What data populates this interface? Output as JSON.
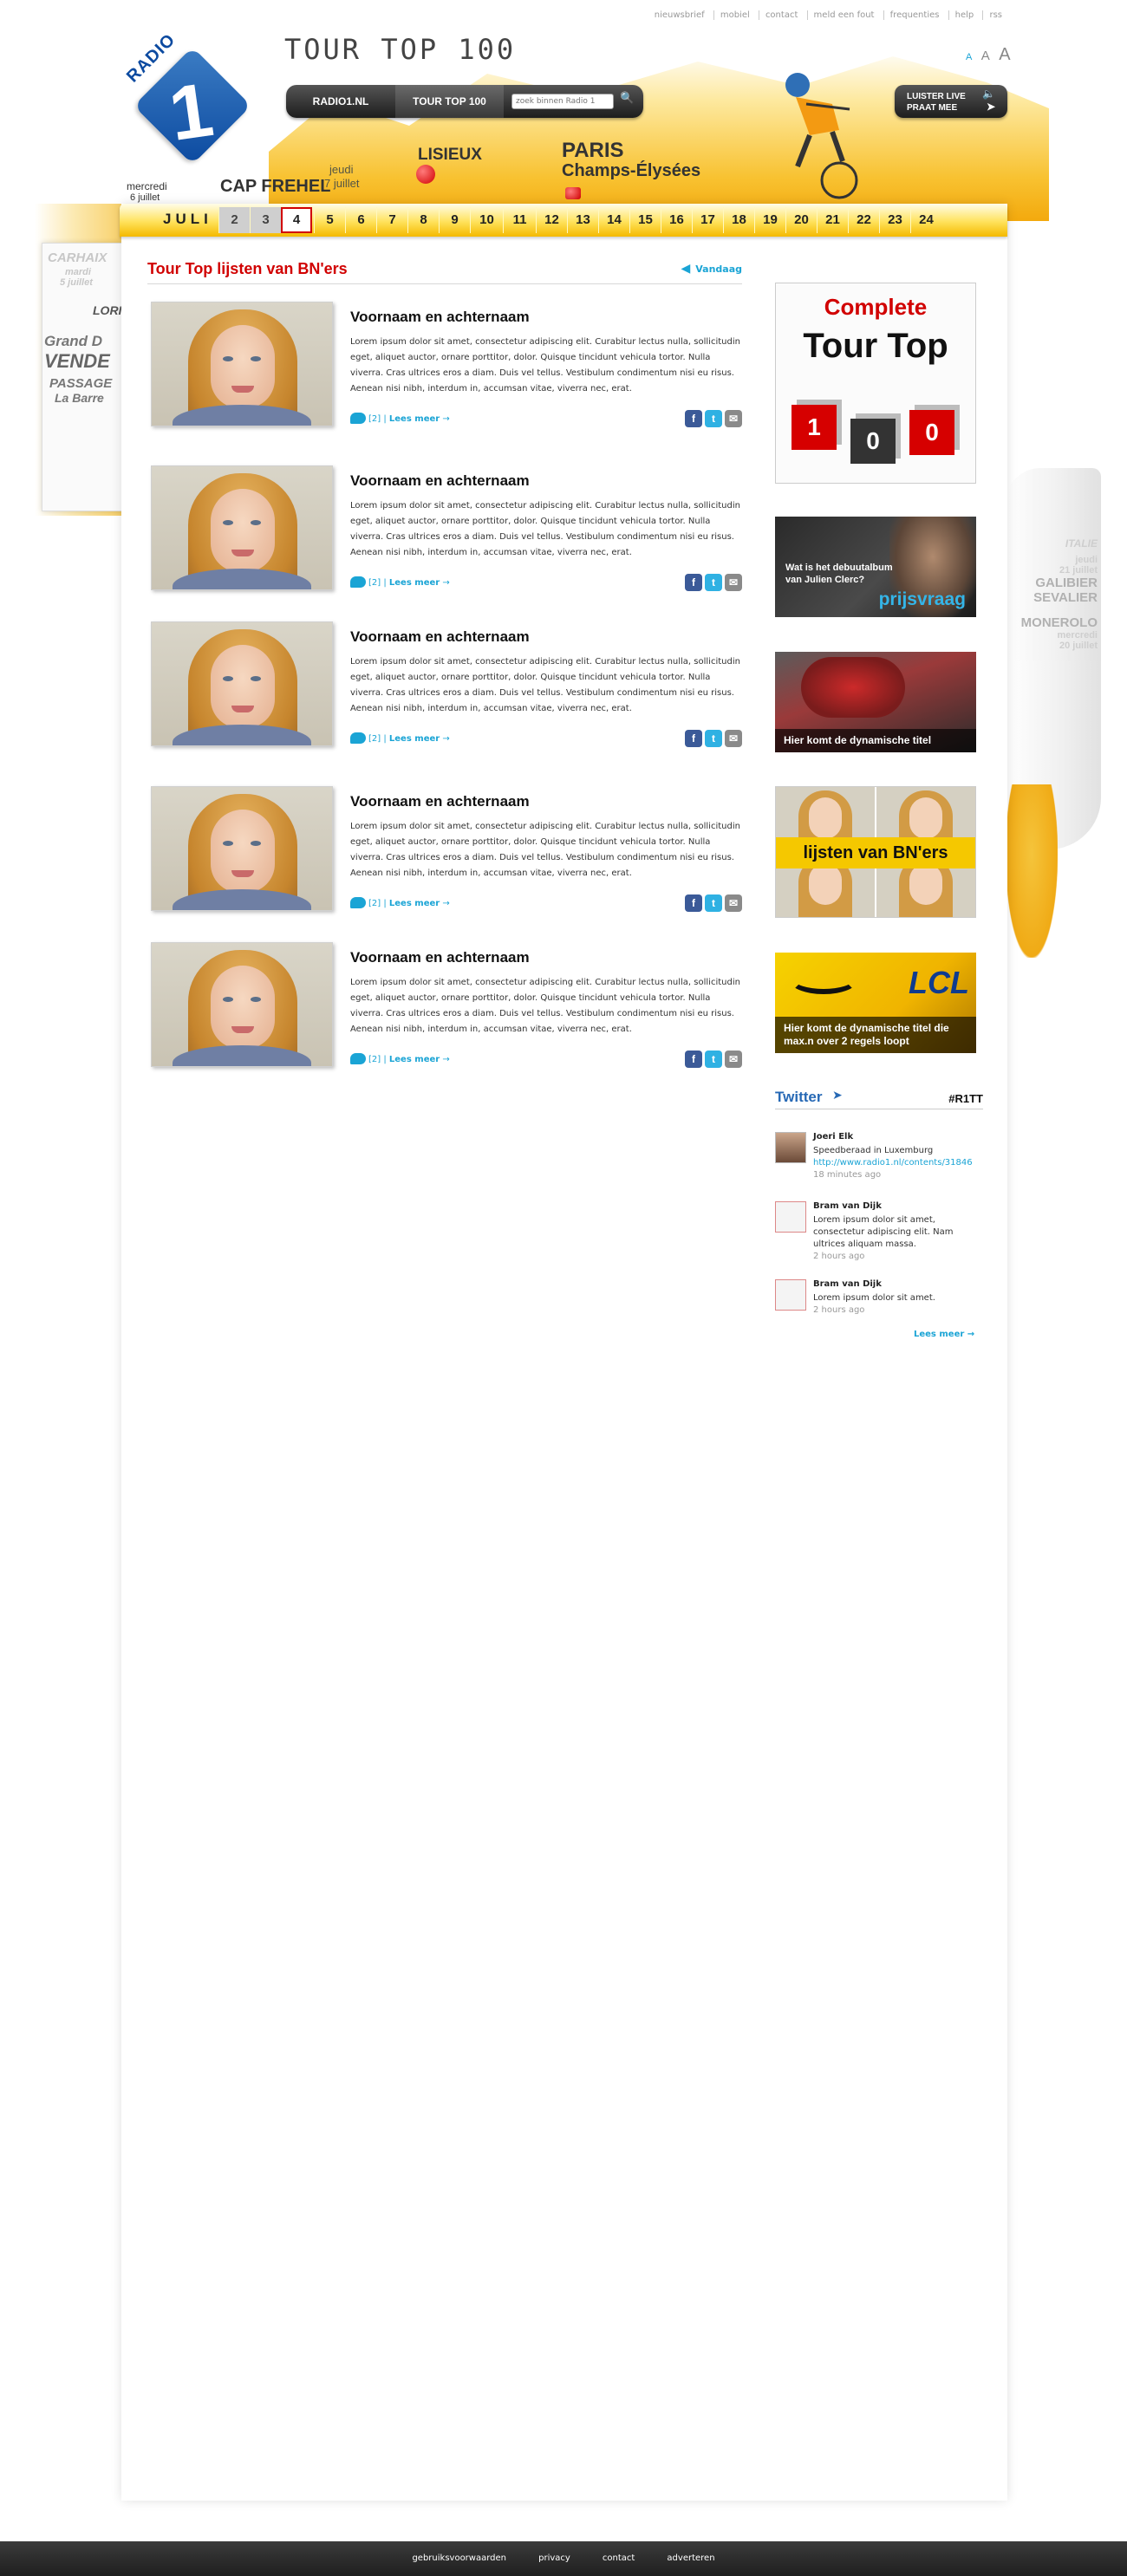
{
  "toplinks": [
    "nieuwsbrief",
    "mobiel",
    "contact",
    "meld een fout",
    "frequenties",
    "help",
    "rss"
  ],
  "font_sizes": [
    "A",
    "A",
    "A"
  ],
  "logo": {
    "word": "RADIO",
    "number": "1"
  },
  "site_title": "TOUR TOP 100",
  "nav": {
    "radio1": "RADIO1.NL",
    "tour": "TOUR TOP 100",
    "search_placeholder": "zoek binnen Radio 1"
  },
  "luister": {
    "line1": "LUISTER LIVE",
    "line2": "PRAAT MEE"
  },
  "map": {
    "stage1_day": "mercredi",
    "stage1_date": "6 juillet",
    "stage1_city": "CAP FREHEL",
    "stage2_day": "jeudi",
    "stage2_date": "7 juillet",
    "stage2_city": "LISIEUX",
    "stage3_city": "PARIS",
    "stage3_sub": "Champs-Élysées"
  },
  "left_card": [
    "CARHAIX",
    "mardi",
    "5 juillet",
    "LORI",
    "Grand D",
    "VENDE",
    "PASSAGE",
    "La Barre"
  ],
  "right_card": [
    "ITALIE",
    "jeudi",
    "21 juillet",
    "GALIBIER",
    "SEVALIER",
    "MONEROLO",
    "mercredi",
    "20 juillet"
  ],
  "datebar": {
    "month": "JULI",
    "days": [
      "2",
      "3",
      "4",
      "5",
      "6",
      "7",
      "8",
      "9",
      "10",
      "11",
      "12",
      "13",
      "14",
      "15",
      "16",
      "17",
      "18",
      "19",
      "20",
      "21",
      "22",
      "23",
      "24"
    ],
    "active": "4"
  },
  "section": {
    "title": "Tour Top lijsten van BN'ers",
    "back": "Vandaag"
  },
  "entries": [
    {
      "title": "Voornaam en achternaam",
      "text": "Lorem ipsum dolor sit amet, consectetur adipiscing elit. Curabitur lectus nulla, sollicitudin eget, aliquet auctor, ornare porttitor, dolor. Quisque tincidunt vehicula tortor. Nulla viverra. Cras ultrices eros a diam. Duis vel tellus. Vestibulum condimentum nisi eu risus. Aenean nisi nibh, interdum in, accumsan vitae, viverra nec, erat.",
      "comments": "[2]",
      "more": "Lees meer"
    },
    {
      "title": "Voornaam en achternaam",
      "text": "Lorem ipsum dolor sit amet, consectetur adipiscing elit. Curabitur lectus nulla, sollicitudin eget, aliquet auctor, ornare porttitor, dolor. Quisque tincidunt vehicula tortor. Nulla viverra. Cras ultrices eros a diam. Duis vel tellus. Vestibulum condimentum nisi eu risus. Aenean nisi nibh, interdum in, accumsan vitae, viverra nec, erat.",
      "comments": "[2]",
      "more": "Lees meer"
    },
    {
      "title": "Voornaam en achternaam",
      "text": "Lorem ipsum dolor sit amet, consectetur adipiscing elit. Curabitur lectus nulla, sollicitudin eget, aliquet auctor, ornare porttitor, dolor. Quisque tincidunt vehicula tortor. Nulla viverra. Cras ultrices eros a diam. Duis vel tellus. Vestibulum condimentum nisi eu risus. Aenean nisi nibh, interdum in, accumsan vitae, viverra nec, erat.",
      "comments": "[2]",
      "more": "Lees meer"
    },
    {
      "title": "Voornaam en achternaam",
      "text": "Lorem ipsum dolor sit amet, consectetur adipiscing elit. Curabitur lectus nulla, sollicitudin eget, aliquet auctor, ornare porttitor, dolor. Quisque tincidunt vehicula tortor. Nulla viverra. Cras ultrices eros a diam. Duis vel tellus. Vestibulum condimentum nisi eu risus. Aenean nisi nibh, interdum in, accumsan vitae, viverra nec, erat.",
      "comments": "[2]",
      "more": "Lees meer"
    },
    {
      "title": "Voornaam en achternaam",
      "text": "Lorem ipsum dolor sit amet, consectetur adipiscing elit. Curabitur lectus nulla, sollicitudin eget, aliquet auctor, ornare porttitor, dolor. Quisque tincidunt vehicula tortor. Nulla viverra. Cras ultrices eros a diam. Duis vel tellus. Vestibulum condimentum nisi eu risus. Aenean nisi nibh, interdum in, accumsan vitae, viverra nec, erat.",
      "comments": "[2]",
      "more": "Lees meer"
    }
  ],
  "sidebar": {
    "complete": {
      "line1": "Complete",
      "line2": "Tour Top",
      "digits": [
        "1",
        "0",
        "0"
      ]
    },
    "prijsvraag": {
      "text": "Wat is het debuutalbum van Julien Clerc?",
      "cta": "prijsvraag"
    },
    "dyn1": {
      "caption": "Hier komt de dynamische titel"
    },
    "bners": {
      "caption": "lijsten van BN'ers"
    },
    "dyn2": {
      "caption": "Hier komt de dynamische titel die max.n over 2 regels loopt",
      "brand": "LCL"
    }
  },
  "twitter": {
    "title": "Twitter",
    "tag": "#R1TT",
    "tweets": [
      {
        "name": "Joeri Elk",
        "text": "Speedberaad in Luxemburg",
        "link": "http://www.radio1.nl/contents/31846",
        "time": "18 minutes ago"
      },
      {
        "name": "Bram van Dijk",
        "text": "Lorem ipsum dolor sit amet, consectetur adipiscing elit. Nam ultrices aliquam massa.",
        "time": "2 hours ago"
      },
      {
        "name": "Bram van Dijk",
        "text": "Lorem ipsum dolor sit amet.",
        "time": "2 hours ago"
      }
    ],
    "more": "Lees meer"
  },
  "footer": [
    "gebruiksvoorwaarden",
    "privacy",
    "contact",
    "adverteren"
  ],
  "colors": {
    "accent_red": "#d10000",
    "link_blue": "#1aa4d5",
    "twitter_blue": "#2769b5",
    "brand_yellow": "#f4b900"
  }
}
